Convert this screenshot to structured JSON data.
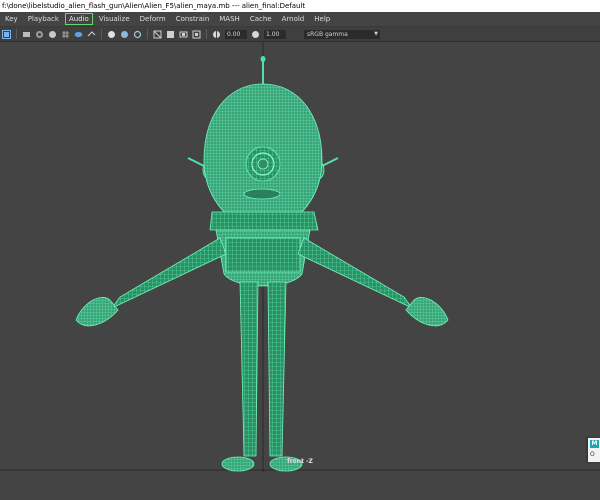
{
  "window": {
    "title": "f:\\done\\libelstudio_alien_flash_gun\\Alien\\Alien_F5\\alien_maya.mb  ---  alien_final:Default"
  },
  "menubar": {
    "items": [
      "Key",
      "Playback",
      "Audio",
      "Visualize",
      "Deform",
      "Constrain",
      "MASH",
      "Cache",
      "Arnold",
      "Help"
    ],
    "active_index": 2
  },
  "toolbar": {
    "exposure_value": "0.00",
    "gamma_value": "1.00",
    "color_space": "sRGB gamma",
    "icons": [
      "select-camera-icon",
      "camera-attributes-icon",
      "bookmark-icon",
      "image-plane-icon",
      "grid-icon",
      "wireframe-icon",
      "smooth-shade-icon",
      "textured-icon",
      "use-lights-icon",
      "shadows-icon",
      "xray-icon",
      "isolate-icon",
      "resolution-gate-icon",
      "hud-icon",
      "exposure-icon",
      "gamma-icon"
    ]
  },
  "viewport": {
    "camera_label": "front -Z",
    "wire_color": "#4ee3a6",
    "background_color": "#444444"
  },
  "side_popup": {
    "badge": "M",
    "text": "O"
  }
}
